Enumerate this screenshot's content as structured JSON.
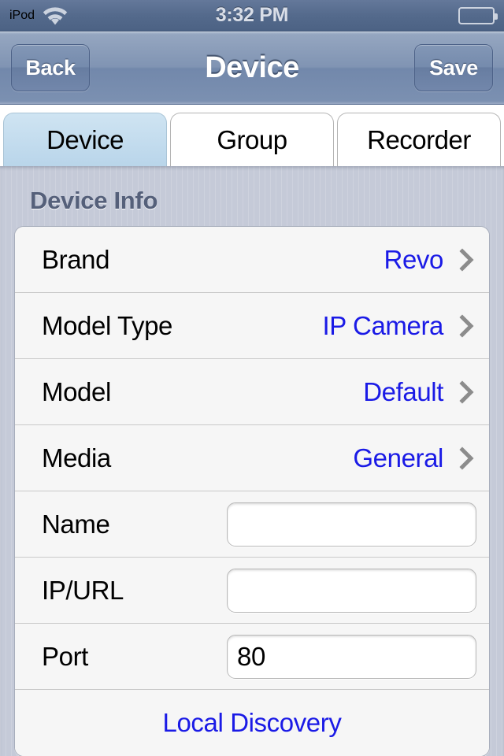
{
  "status_bar": {
    "carrier": "iPod",
    "wifi_icon": "wifi-icon",
    "time": "3:32 PM",
    "battery_icon": "battery-icon"
  },
  "nav_bar": {
    "back_label": "Back",
    "title": "Device",
    "save_label": "Save"
  },
  "tabs": [
    {
      "label": "Device",
      "active": true
    },
    {
      "label": "Group",
      "active": false
    },
    {
      "label": "Recorder",
      "active": false
    }
  ],
  "section": {
    "header": "Device Info"
  },
  "rows": [
    {
      "label": "Brand",
      "value": "Revo",
      "type": "disclosure"
    },
    {
      "label": "Model Type",
      "value": "IP Camera",
      "type": "disclosure"
    },
    {
      "label": "Model",
      "value": "Default",
      "type": "disclosure"
    },
    {
      "label": "Media",
      "value": "General",
      "type": "disclosure"
    },
    {
      "label": "Name",
      "value": "",
      "placeholder": "",
      "type": "input"
    },
    {
      "label": "IP/URL",
      "value": "",
      "placeholder": "",
      "type": "input"
    },
    {
      "label": "Port",
      "value": "80",
      "placeholder": "",
      "type": "input"
    }
  ],
  "action_row": {
    "label": "Local Discovery"
  },
  "colors": {
    "accent_blue": "#1a1ae6",
    "status_bar_blue": "#546a8c",
    "nav_bar_blue": "#7b90b1",
    "tab_active_blue": "#c3dcee",
    "content_bg": "#c5cad8",
    "cell_bg": "#f6f6f6",
    "section_header": "#55607a",
    "chevron_gray": "#8c8c8c"
  }
}
